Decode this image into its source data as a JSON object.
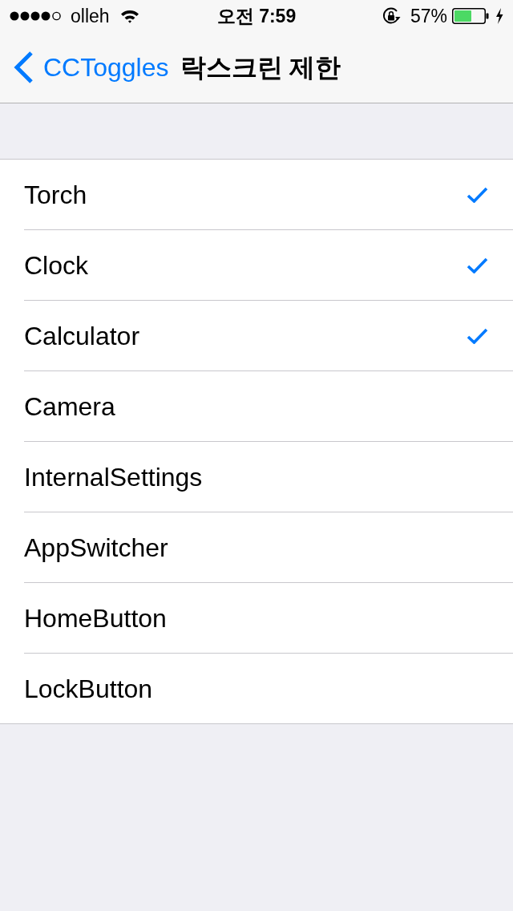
{
  "status_bar": {
    "carrier": "olleh",
    "time": "오전 7:59",
    "battery": "57%"
  },
  "nav_bar": {
    "back": "CCToggles",
    "title": "락스크린 제한"
  },
  "items": [
    {
      "label": "Torch",
      "checked": true
    },
    {
      "label": "Clock",
      "checked": true
    },
    {
      "label": "Calculator",
      "checked": true
    },
    {
      "label": "Camera",
      "checked": false
    },
    {
      "label": "InternalSettings",
      "checked": false
    },
    {
      "label": "AppSwitcher",
      "checked": false
    },
    {
      "label": "HomeButton",
      "checked": false
    },
    {
      "label": "LockButton",
      "checked": false
    }
  ]
}
